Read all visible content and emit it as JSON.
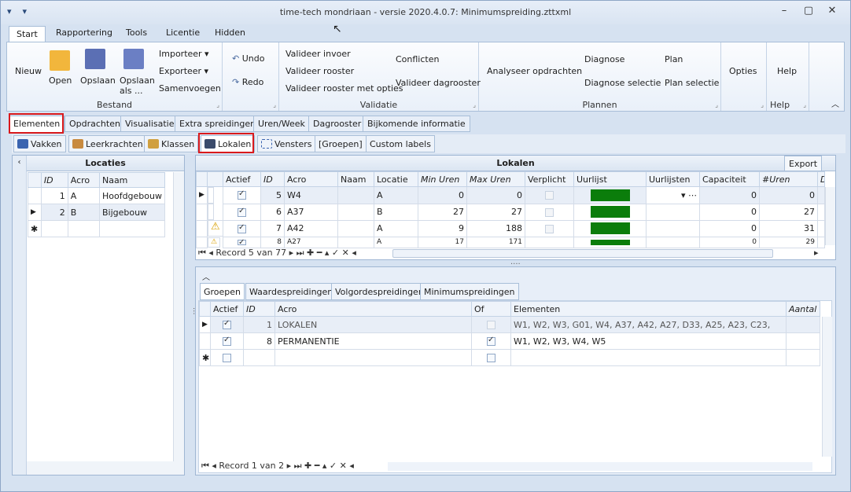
{
  "window": {
    "title": "time-tech mondriaan - versie 2020.4.0.7: Minimumspreiding.zttxml",
    "qat": [
      "▾",
      "▾"
    ],
    "controls": [
      "–",
      "▢",
      "✕"
    ]
  },
  "ribbon_tabs": [
    "Start",
    "Rapportering",
    "Tools",
    "Licentie",
    "Hidden"
  ],
  "ribbon": {
    "bestand": {
      "label": "Bestand",
      "nieuw": "Nieuw",
      "open": "Open",
      "opslaan": "Opslaan",
      "opslaan_als": "Opslaan\nals ...",
      "importeer": "Importeer ▾",
      "exporteer": "Exporteer ▾",
      "samenvoegen": "Samenvoegen"
    },
    "undo": "Undo",
    "redo": "Redo",
    "validatie": {
      "label": "Validatie",
      "invoer": "Valideer invoer",
      "rooster": "Valideer rooster",
      "opties": "Valideer rooster met opties",
      "conflicten": "Conflicten",
      "dagrooster": "Valideer dagrooster"
    },
    "plannen": {
      "label": "Plannen",
      "analyseer": "Analyseer opdrachten",
      "diagnose": "Diagnose",
      "diagnose_sel": "Diagnose selectie",
      "plan": "Plan",
      "plan_sel": "Plan selectie"
    },
    "opties": "Opties",
    "help": "Help",
    "help_label": "Help"
  },
  "tabs_main": [
    "Elementen",
    "Opdrachten",
    "Visualisatie",
    "Extra spreidingen",
    "Uren/Week",
    "Dagrooster",
    "Bijkomende informatie"
  ],
  "tabs_sub": [
    "Vakken",
    "Leerkrachten",
    "Klassen",
    "Lokalen",
    "Vensters",
    "[Groepen]",
    "Custom labels"
  ],
  "locaties": {
    "title": "Locaties",
    "cols": [
      "ID",
      "Acro",
      "Naam"
    ],
    "rows": [
      [
        "1",
        "A",
        "Hoofdgebouw"
      ],
      [
        "2",
        "B",
        "Bijgebouw"
      ]
    ]
  },
  "lokalen": {
    "title": "Lokalen",
    "export": "Export",
    "cols": [
      "Actief",
      "ID",
      "Acro",
      "Naam",
      "Locatie",
      "Min Uren",
      "Max Uren",
      "Verplicht",
      "Uurlijst",
      "Uurlijsten",
      "Capaciteit",
      "#Uren",
      "Diff"
    ],
    "rows": [
      [
        "",
        "5",
        "W4",
        "",
        "A",
        "0",
        "0",
        "",
        "",
        "",
        "0",
        "0"
      ],
      [
        "",
        "6",
        "A37",
        "",
        "B",
        "27",
        "27",
        "",
        "",
        "",
        "0",
        "27"
      ],
      [
        "⚠",
        "7",
        "A42",
        "",
        "A",
        "9",
        "188",
        "",
        "",
        "",
        "0",
        "31"
      ],
      [
        "⚠",
        "8",
        "A27",
        "",
        "A",
        "17",
        "171",
        "",
        "",
        "",
        "0",
        "29"
      ]
    ],
    "record": "Record 5 van 77"
  },
  "bottom_tabs": [
    "Groepen",
    "Waardespreidingen",
    "Volgordespreidingen",
    "Minimumspreidingen"
  ],
  "groepen": {
    "cols": [
      "Actief",
      "ID",
      "Acro",
      "Of",
      "Elementen",
      "Aantal"
    ],
    "rows": [
      [
        "1",
        "LOKALEN",
        "W1, W2, W3, G01, W4, A37, A42, A27, D33, A25, A23, C23,"
      ],
      [
        "8",
        "PERMANENTIE",
        "W1, W2, W3, W4, W5"
      ]
    ],
    "record": "Record 1 van 2"
  }
}
